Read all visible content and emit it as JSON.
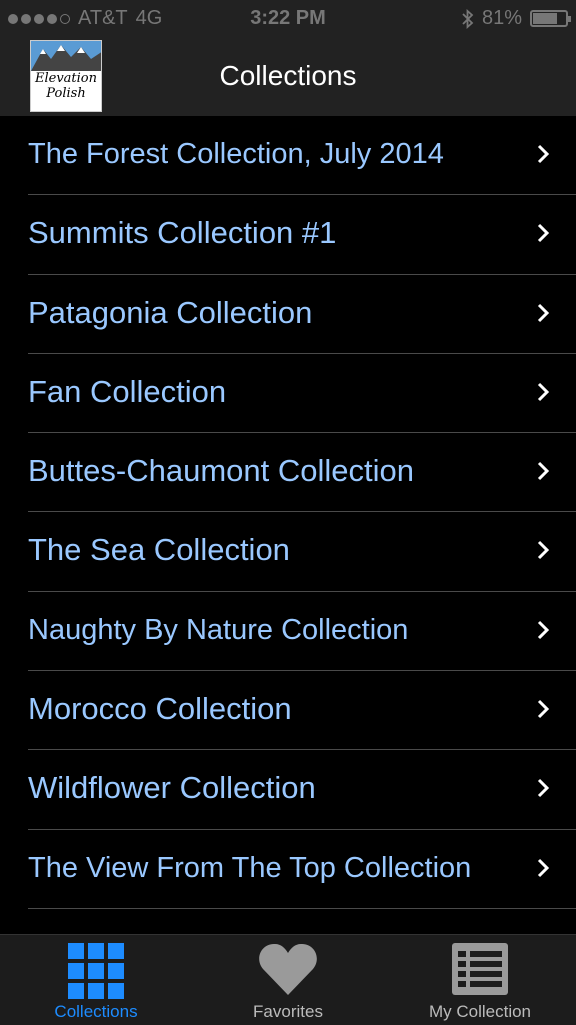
{
  "status_bar": {
    "carrier": "AT&T",
    "network": "4G",
    "time": "3:22 PM",
    "battery_percent": "81%",
    "battery_level": 0.81
  },
  "nav": {
    "title": "Collections",
    "logo_line1": "Elevation",
    "logo_line2": "Polish"
  },
  "collections": [
    {
      "label": "The Forest Collection, July 2014"
    },
    {
      "label": "Summits Collection #1"
    },
    {
      "label": "Patagonia Collection"
    },
    {
      "label": "Fan Collection"
    },
    {
      "label": "Buttes-Chaumont Collection"
    },
    {
      "label": "The Sea Collection"
    },
    {
      "label": "Naughty By Nature Collection"
    },
    {
      "label": "Morocco Collection"
    },
    {
      "label": "Wildflower Collection"
    },
    {
      "label": "The View From The Top Collection"
    }
  ],
  "tabs": [
    {
      "label": "Collections",
      "icon": "grid-icon",
      "active": true
    },
    {
      "label": "Favorites",
      "icon": "heart-icon",
      "active": false
    },
    {
      "label": "My Collection",
      "icon": "list-icon",
      "active": false
    }
  ],
  "colors": {
    "accent": "#1d8cff",
    "list_text": "#9ac8ff",
    "background": "#000000"
  }
}
